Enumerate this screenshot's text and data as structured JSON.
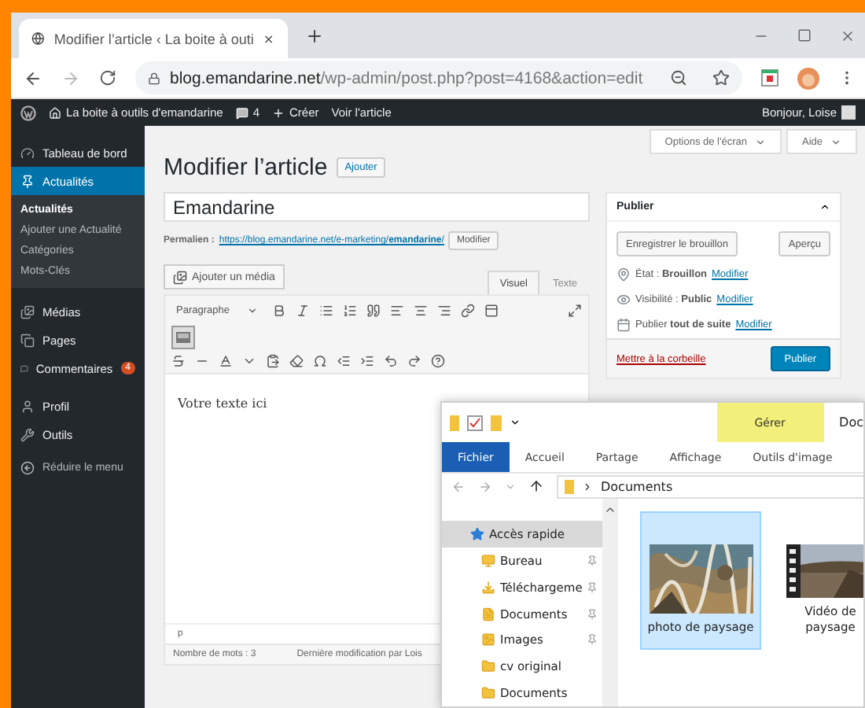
{
  "browser": {
    "tab_title": "Modifier l’article ‹ La boite à outi",
    "url_host": "blog.emandarine.net",
    "url_path": "/wp-admin/post.php?post=4168&action=edit"
  },
  "admin_bar": {
    "site": "La boite à outils d'emandarine",
    "comments": "4",
    "new": "Créer",
    "view": "Voir l'article",
    "greeting": "Bonjour, Loise"
  },
  "sidebar": {
    "groups": [
      [
        {
          "label": "Tableau de bord",
          "selected": false
        },
        {
          "label": "Actualités",
          "selected": true,
          "children": [
            {
              "label": "Actualités",
              "selected": true
            },
            {
              "label": "Ajouter une Actualité",
              "selected": false
            },
            {
              "label": "Catégories",
              "selected": false
            },
            {
              "label": "Mots-Clés",
              "selected": false
            }
          ]
        }
      ],
      [
        {
          "label": "Médias",
          "selected": false
        },
        {
          "label": "Pages",
          "selected": false
        },
        {
          "label": "Commentaires",
          "selected": false,
          "badge": "4"
        }
      ],
      [
        {
          "label": "Profil",
          "selected": false
        },
        {
          "label": "Outils",
          "selected": false
        }
      ]
    ],
    "collapse": "Réduire le menu"
  },
  "header": {
    "screen_options": "Options de l'écran",
    "help": "Aide",
    "title": "Modifier l’article",
    "add_new": "Ajouter"
  },
  "post": {
    "title": "Emandarine",
    "permalink_label": "Permalien :",
    "permalink_url": "https://blog.emandarine.net/e-marketing/**emandarine**/",
    "edit_slug": "Modifier"
  },
  "editor": {
    "add_media": "Ajouter un média",
    "tabs": [
      {
        "label": "Visuel",
        "selected": true
      },
      {
        "label": "Texte",
        "selected": false
      }
    ],
    "format": "Paragraphe",
    "kitchen_sink_on": true,
    "content": "Votre texte ici",
    "path": "p",
    "word_count": "Nombre de mots : 3",
    "last_modified": "Dernière modification par Lois"
  },
  "publish": {
    "title": "Publier",
    "save_draft": "Enregistrer le brouillon",
    "preview": "Aperçu",
    "rows": [
      {
        "text": "État : **Brouillon**",
        "link": "Modifier"
      },
      {
        "text": "Visibilité : **Public**",
        "link": "Modifier"
      },
      {
        "text": "Publier **tout de suite**",
        "link": "Modifier"
      }
    ],
    "trash": "Mettre à la corbeille",
    "publish": "Publier"
  },
  "explorer": {
    "context_tab": "Gérer",
    "title_cut": "Doc",
    "ribbon_tabs": [
      {
        "label": "Fichier",
        "selected": true
      },
      {
        "label": "Accueil",
        "selected": false
      },
      {
        "label": "Partage",
        "selected": false
      },
      {
        "label": "Affichage",
        "selected": false
      },
      {
        "label": "Outils d'image",
        "selected": false
      }
    ],
    "path": "Documents",
    "nav": [
      {
        "label": "Accès rapide",
        "selected": true,
        "pinned": false
      },
      {
        "label": "Bureau",
        "selected": false,
        "pinned": true
      },
      {
        "label": "Téléchargeme",
        "selected": false,
        "pinned": true
      },
      {
        "label": "Documents",
        "selected": false,
        "pinned": true
      },
      {
        "label": "Images",
        "selected": false,
        "pinned": true
      },
      {
        "label": "cv original",
        "selected": false,
        "pinned": false
      },
      {
        "label": "Documents",
        "selected": false,
        "pinned": false
      }
    ],
    "files": [
      {
        "name": "photo de paysage",
        "selected": true
      },
      {
        "name": "Vidéo de paysage",
        "kind": "video",
        "selected": false
      }
    ]
  }
}
